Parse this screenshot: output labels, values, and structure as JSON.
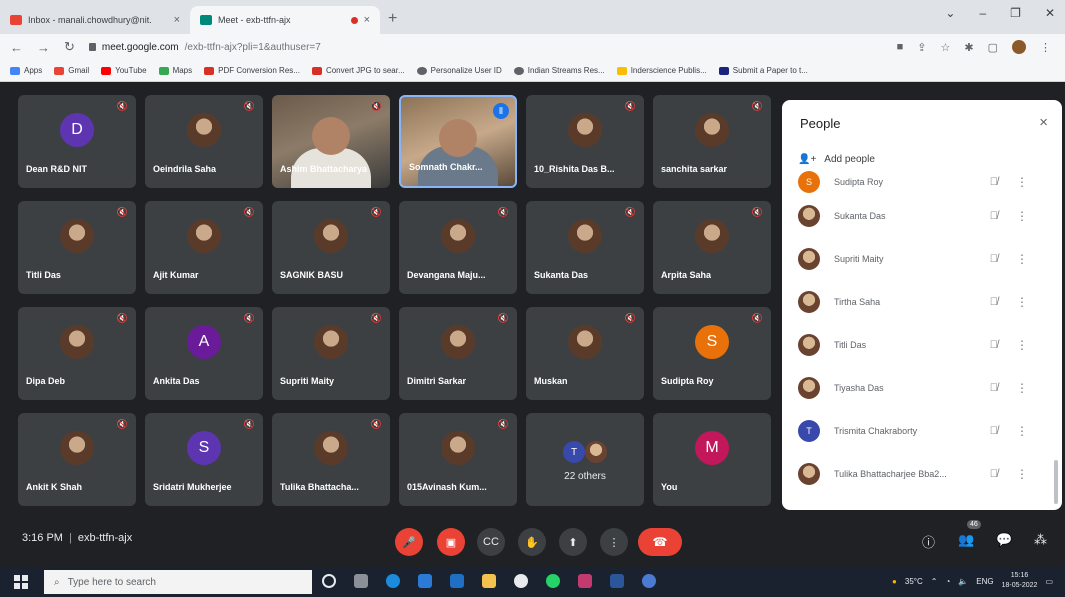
{
  "browser": {
    "tabs": [
      {
        "title": "Inbox - manali.chowdhury@nit.",
        "close": "×"
      },
      {
        "title": "Meet - exb-ttfn-ajx",
        "close": "×"
      }
    ],
    "new_tab": "+",
    "window_controls": [
      "⌄",
      "–",
      "❐",
      "✕"
    ],
    "url_host": "meet.google.com",
    "url_path": "/exb-ttfn-ajx?pli=1&authuser=7",
    "bookmarks": [
      {
        "label": "Apps",
        "color": "#4285f4"
      },
      {
        "label": "Gmail",
        "color": "#ea4335"
      },
      {
        "label": "YouTube",
        "color": "#ff0000"
      },
      {
        "label": "Maps",
        "color": "#34a853"
      },
      {
        "label": "PDF Conversion Res...",
        "color": "#d93025"
      },
      {
        "label": "Convert JPG to sear...",
        "color": "#d93025"
      },
      {
        "label": "Personalize User ID",
        "color": "#5f6368"
      },
      {
        "label": "Indian Streams Res...",
        "color": "#5f6368"
      },
      {
        "label": "Inderscience Publis...",
        "color": "#fbbc04"
      },
      {
        "label": "Submit a Paper to t...",
        "color": "#1a237e"
      }
    ]
  },
  "meet": {
    "tiles": [
      {
        "name": "Dean R&D NIT",
        "type": "letter",
        "letter": "D",
        "color": "#5e35b1"
      },
      {
        "name": "Oeindrila Saha",
        "type": "photo"
      },
      {
        "name": "Ashim Bhattacharya",
        "type": "video"
      },
      {
        "name": "Somnath Chakr...",
        "type": "video2"
      },
      {
        "name": "10_Rishita Das B...",
        "type": "photo"
      },
      {
        "name": "sanchita sarkar",
        "type": "photo"
      },
      {
        "name": "Titli Das",
        "type": "photo"
      },
      {
        "name": "Ajit Kumar",
        "type": "photo"
      },
      {
        "name": "SAGNIK BASU",
        "type": "photo"
      },
      {
        "name": "Devangana Maju...",
        "type": "photo"
      },
      {
        "name": "Sukanta Das",
        "type": "photo"
      },
      {
        "name": "Arpita Saha",
        "type": "photo"
      },
      {
        "name": "Dipa Deb",
        "type": "photo"
      },
      {
        "name": "Ankita Das",
        "type": "letter",
        "letter": "A",
        "color": "#6a1b9a"
      },
      {
        "name": "Supriti Maity",
        "type": "photo"
      },
      {
        "name": "Dimitri Sarkar",
        "type": "photo"
      },
      {
        "name": "Muskan",
        "type": "photo"
      },
      {
        "name": "Sudipta Roy",
        "type": "letter",
        "letter": "S",
        "color": "#e8710a"
      },
      {
        "name": "Ankit K Shah",
        "type": "photo"
      },
      {
        "name": "Sridatri Mukherjee",
        "type": "letter",
        "letter": "S",
        "color": "#5e35b1"
      },
      {
        "name": "Tulika Bhattacha...",
        "type": "photo"
      },
      {
        "name": "015Avinash Kum...",
        "type": "photo"
      },
      {
        "name": "",
        "type": "others",
        "label": "22 others",
        "letter": "T"
      },
      {
        "name": "You",
        "type": "letter",
        "letter": "M",
        "color": "#c2185b"
      }
    ],
    "mute_glyph": "🎙̸",
    "meeting_time": "3:16 PM",
    "meeting_code": "exb-ttfn-ajx",
    "participant_count": "46"
  },
  "people_panel": {
    "title": "People",
    "close": "×",
    "add_people": "Add people",
    "participants": [
      {
        "name": "Sudipta Roy",
        "letter": "S",
        "color": "#e8710a"
      },
      {
        "name": "Sukanta Das",
        "letter": "",
        "color": ""
      },
      {
        "name": "Supriti Maity",
        "letter": "",
        "color": ""
      },
      {
        "name": "Tirtha Saha",
        "letter": "",
        "color": ""
      },
      {
        "name": "Titli Das",
        "letter": "",
        "color": ""
      },
      {
        "name": "Tiyasha Das",
        "letter": "",
        "color": ""
      },
      {
        "name": "Trismita Chakraborty",
        "letter": "T",
        "color": "#3949ab"
      },
      {
        "name": "Tulika Bhattacharjee Bba2...",
        "letter": "",
        "color": ""
      }
    ]
  },
  "taskbar": {
    "search_placeholder": "Type here to search",
    "weather": "35°C",
    "language": "ENG",
    "time": "15:16",
    "date": "18-05-2022"
  }
}
